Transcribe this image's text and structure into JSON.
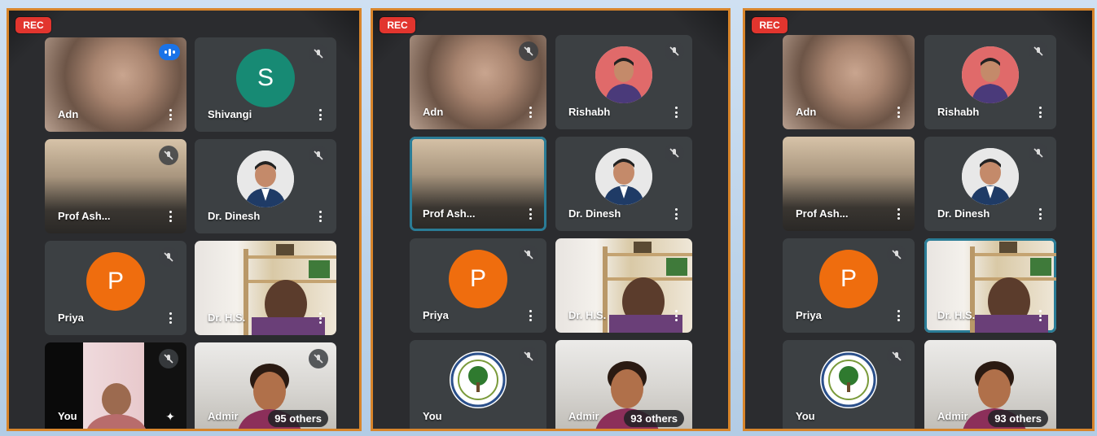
{
  "rec_label": "REC",
  "colors": {
    "frame": "#d8852b",
    "rec": "#e2352e",
    "shivangi": "#178a74",
    "priya": "#ef6d0e",
    "active": "#2a7c96"
  },
  "panels": [
    {
      "tiles": [
        {
          "name": "Adn",
          "kind": "photo",
          "photo": "adm"
        },
        {
          "name": "Shivangi",
          "kind": "letter",
          "letter": "S"
        },
        {
          "name": "Prof Ash...",
          "kind": "photo",
          "photo": "prof"
        },
        {
          "name": "Dr. Dinesh",
          "kind": "avatar"
        },
        {
          "name": "Priya",
          "kind": "letter",
          "letter": "P"
        },
        {
          "name": "Dr. H.S.",
          "kind": "photo",
          "photo": "hs"
        },
        {
          "name": "You",
          "kind": "photo",
          "photo": "you1"
        },
        {
          "name": "Admir",
          "kind": "photo",
          "photo": "admin",
          "others": "95 others"
        }
      ]
    },
    {
      "tiles": [
        {
          "name": "Adn",
          "kind": "photo",
          "photo": "adm"
        },
        {
          "name": "Rishabh",
          "kind": "avatar"
        },
        {
          "name": "Prof Ash...",
          "kind": "photo",
          "photo": "prof"
        },
        {
          "name": "Dr. Dinesh",
          "kind": "avatar"
        },
        {
          "name": "Priya",
          "kind": "letter",
          "letter": "P"
        },
        {
          "name": "Dr. H.S.",
          "kind": "photo",
          "photo": "hs"
        },
        {
          "name": "You",
          "kind": "logo"
        },
        {
          "name": "Admir",
          "kind": "photo",
          "photo": "admin",
          "others": "93 others"
        }
      ]
    },
    {
      "tiles": [
        {
          "name": "Adn",
          "kind": "photo",
          "photo": "adm"
        },
        {
          "name": "Rishabh",
          "kind": "avatar"
        },
        {
          "name": "Prof Ash...",
          "kind": "photo",
          "photo": "prof"
        },
        {
          "name": "Dr. Dinesh",
          "kind": "avatar"
        },
        {
          "name": "Priya",
          "kind": "letter",
          "letter": "P"
        },
        {
          "name": "Dr. H.S.",
          "kind": "photo",
          "photo": "hs"
        },
        {
          "name": "You",
          "kind": "logo"
        },
        {
          "name": "Admir",
          "kind": "photo",
          "photo": "admin",
          "others": "93 others"
        }
      ]
    }
  ]
}
